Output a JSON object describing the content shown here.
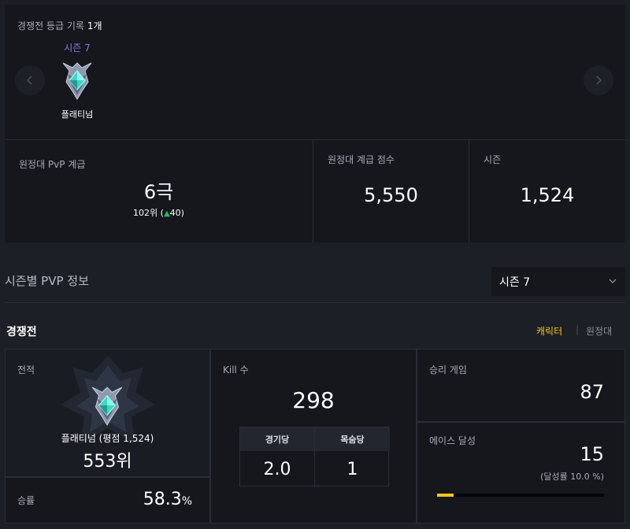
{
  "competitive_history": {
    "header_label": "경쟁전 등급 기록",
    "count": "1개",
    "season": "시즌 7",
    "tier": "플래티넘"
  },
  "expedition_stats": {
    "pvp_grade_label": "원정대 PvP 계급",
    "pvp_grade_value": "6극",
    "rank_text": "102위 (",
    "rank_change": "40",
    "rank_close": ")",
    "grade_score_label": "원정대 계급 점수",
    "grade_score_value": "5,550",
    "season_label": "시즌",
    "season_value": "1,524"
  },
  "season_info": {
    "title": "시즌별 PVP 정보",
    "selected_season": "시즌 7"
  },
  "competitive": {
    "title": "경쟁전",
    "toggle_character": "캐릭터",
    "toggle_separator": "|",
    "toggle_expedition": "원정대",
    "record_label": "전적",
    "tier_text": "플래티넘 (평점 1,524)",
    "rank": "553위",
    "winrate_label": "승률",
    "winrate_value": "58.3",
    "winrate_unit": "%",
    "kill_label": "Kill 수",
    "kill_value": "298",
    "per_game_label": "경기당",
    "per_game_value": "2.0",
    "per_life_label": "목숨당",
    "per_life_value": "1",
    "wins_label": "승리 게임",
    "wins_value": "87",
    "ace_label": "에이스 달성",
    "ace_value": "15",
    "ace_rate_text": "(달성률 10.0 %)",
    "ace_rate_fraction": 0.1
  },
  "colors": {
    "accent_yellow": "#f5c518",
    "season_purple": "#8b79e8",
    "rank_up_green": "#19c05a",
    "panel_bg": "#15171d",
    "page_bg": "#1d1f26"
  },
  "icons": {
    "prev": "chevron-left-icon",
    "next": "chevron-right-icon",
    "dropdown": "chevron-down-icon",
    "tier_emblem": "platinum-emblem-icon",
    "rank_up": "triangle-up-icon"
  }
}
